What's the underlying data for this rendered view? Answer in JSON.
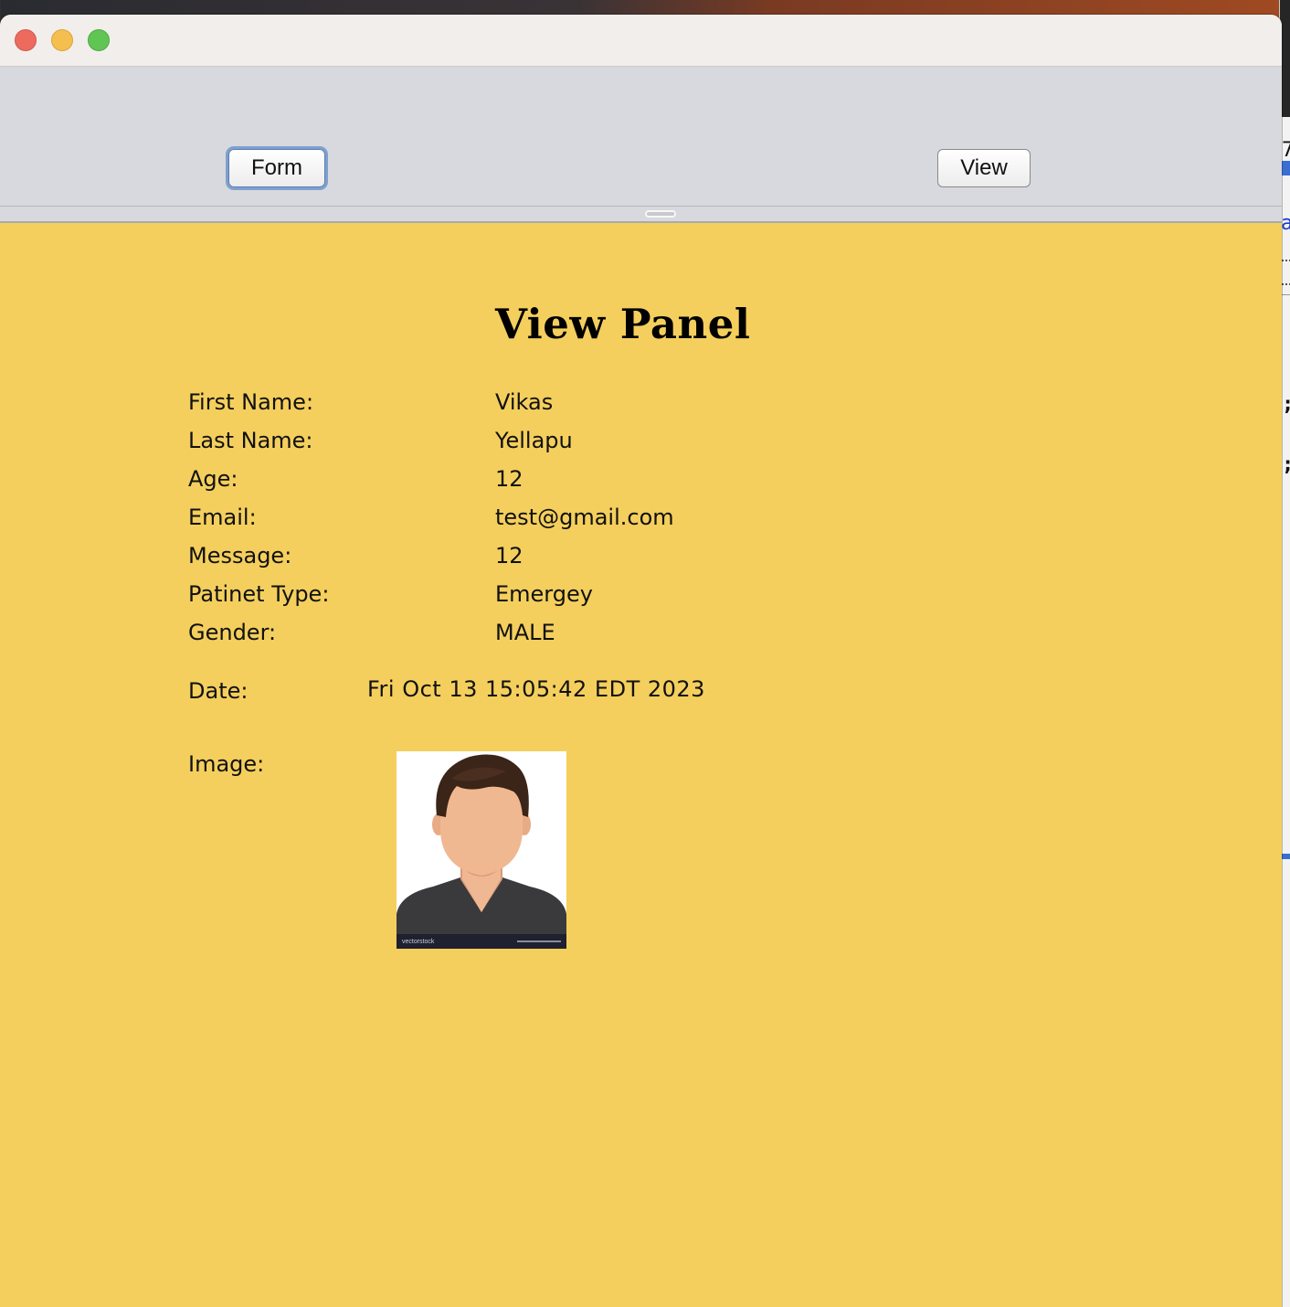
{
  "toolbar": {
    "form_label": "Form",
    "view_label": "View"
  },
  "panel": {
    "title": "View Panel",
    "fields": [
      {
        "label": "First Name:",
        "value": "Vikas"
      },
      {
        "label": "Last Name:",
        "value": "Yellapu"
      },
      {
        "label": "Age:",
        "value": "12"
      },
      {
        "label": "Email:",
        "value": "test@gmail.com"
      },
      {
        "label": "Message:",
        "value": "12"
      },
      {
        "label": "Patinet Type:",
        "value": "Emergey"
      },
      {
        "label": "Gender:",
        "value": "MALE"
      }
    ],
    "date": {
      "label": "Date:",
      "value": "Fri Oct 13 15:05:42 EDT 2023"
    },
    "image": {
      "label": "Image:",
      "icon": "person-avatar-icon",
      "watermark": "vectorstock"
    }
  },
  "background_chars": {
    "c1": "7",
    "c2": "a",
    "c3": ";",
    "c4": ";"
  },
  "colors": {
    "panel_bg": "#f4cf5d",
    "toolbar_bg": "#d8d9de",
    "titlebar_bg": "#f2eeeb",
    "focus_ring": "#7fa0cf"
  }
}
